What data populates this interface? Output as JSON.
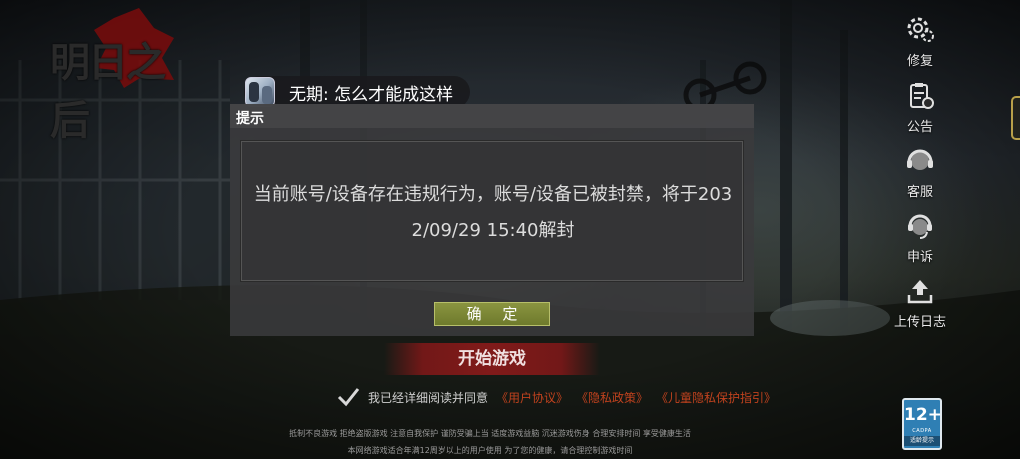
{
  "game": {
    "logo_text": "明日之后"
  },
  "side_menu": {
    "items": [
      {
        "label": "修复",
        "icon": "gear-repair-icon"
      },
      {
        "label": "公告",
        "icon": "notice-clipboard-icon"
      },
      {
        "label": "客服",
        "icon": "customer-service-headset-icon"
      },
      {
        "label": "申诉",
        "icon": "appeal-headset-icon"
      },
      {
        "label": "上传日志",
        "icon": "upload-log-icon"
      }
    ]
  },
  "chat": {
    "message": "无期: 怎么才能成这样"
  },
  "dialog": {
    "title": "提示",
    "message_line1": "当前账号/设备存在违规行为，账号/设备已被封禁，将于203",
    "message_line2": "2/09/29 15:40解封",
    "confirm_label": "确 定"
  },
  "start_button": {
    "label": "开始游戏"
  },
  "agreement": {
    "text": "我已经详细阅读并同意",
    "links": [
      "《用户协议》",
      "《隐私政策》",
      "《儿童隐私保护指引》"
    ],
    "checked": true
  },
  "footer": {
    "line1": "抵制不良游戏 拒绝盗版游戏 注意自我保护 谨防受骗上当 适度游戏益脑 沉迷游戏伤身 合理安排时间 享受健康生活",
    "line2": "本网络游戏适合年满12周岁以上的用户使用   为了您的健康，请合理控制游戏时间"
  },
  "age_rating": {
    "rating": "12+",
    "org": "CADPA",
    "note": "适龄提示"
  },
  "colors": {
    "confirm": "#7a8634",
    "start": "#8c1a1a",
    "link": "#c0421e",
    "badge": "#2f7fb4"
  }
}
